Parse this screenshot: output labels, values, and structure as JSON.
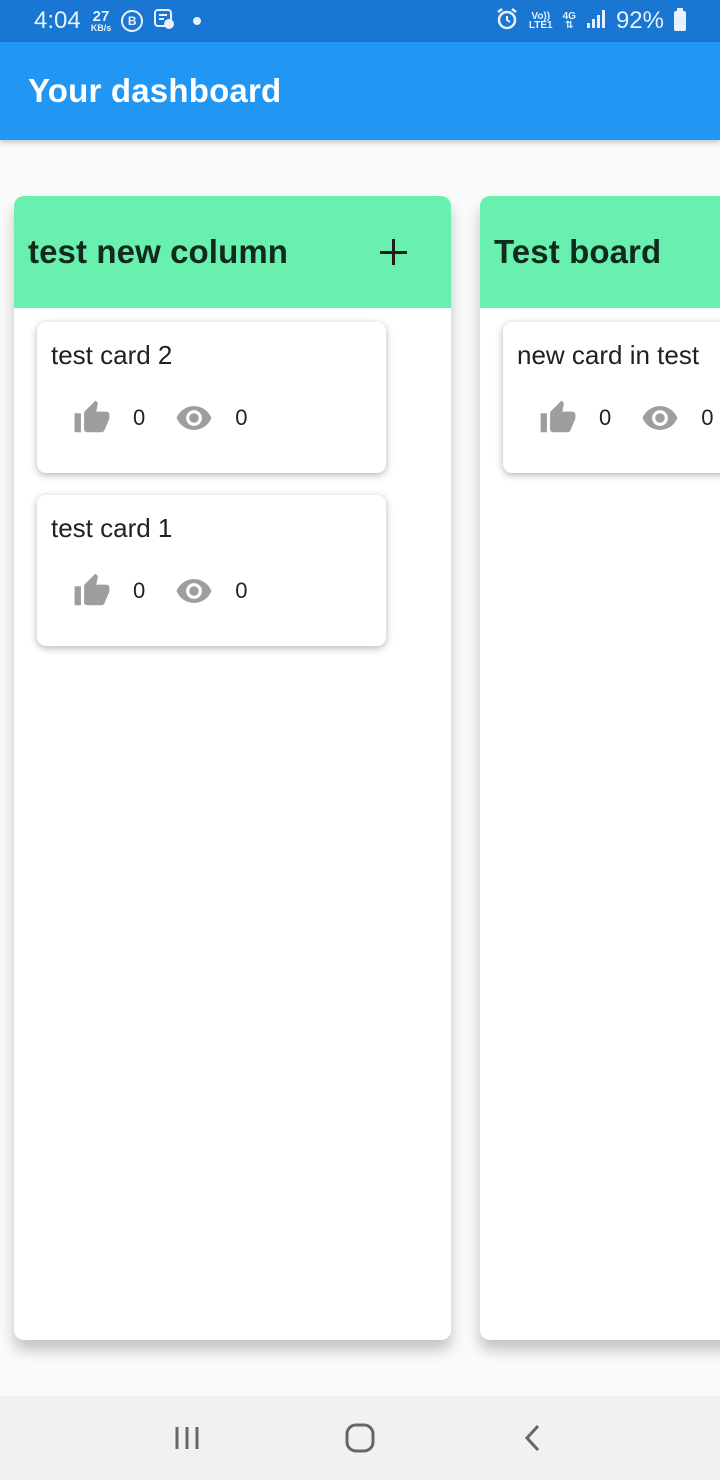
{
  "status_bar": {
    "time": "4:04",
    "speed_value": "27",
    "speed_unit": "KB/s",
    "b_badge": "B",
    "network_top": "Vo))",
    "network_bottom": "LTE1",
    "signal_type": "4G",
    "battery_percent": "92%"
  },
  "app_bar": {
    "title": "Your dashboard",
    "color": "#2196f3"
  },
  "columns": [
    {
      "title": "test new column",
      "header_color": "#69f0ae",
      "cards": [
        {
          "title": "test card 2",
          "likes": "0",
          "views": "0"
        },
        {
          "title": "test card 1",
          "likes": "0",
          "views": "0"
        }
      ]
    },
    {
      "title": "Test board",
      "header_color": "#69f0ae",
      "cards": [
        {
          "title": "new card in test",
          "likes": "0",
          "views": "0"
        }
      ]
    }
  ],
  "nav_bar": {
    "items": [
      "recent-apps",
      "home",
      "back"
    ]
  }
}
